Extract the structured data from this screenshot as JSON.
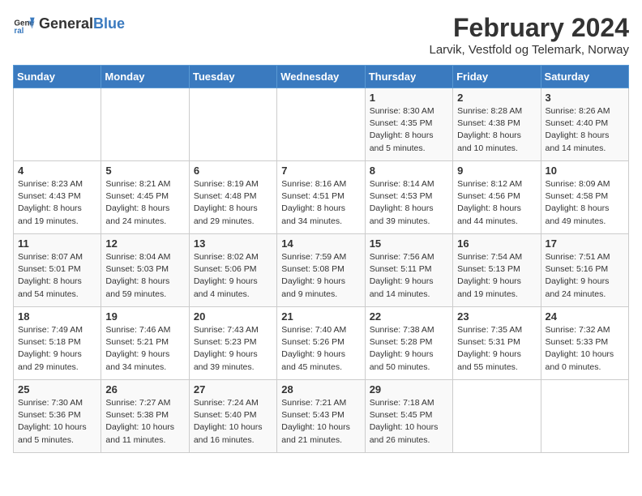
{
  "header": {
    "logo_general": "General",
    "logo_blue": "Blue",
    "month_year": "February 2024",
    "location": "Larvik, Vestfold og Telemark, Norway"
  },
  "calendar": {
    "days_of_week": [
      "Sunday",
      "Monday",
      "Tuesday",
      "Wednesday",
      "Thursday",
      "Friday",
      "Saturday"
    ],
    "weeks": [
      [
        {
          "day": "",
          "info": ""
        },
        {
          "day": "",
          "info": ""
        },
        {
          "day": "",
          "info": ""
        },
        {
          "day": "",
          "info": ""
        },
        {
          "day": "1",
          "info": "Sunrise: 8:30 AM\nSunset: 4:35 PM\nDaylight: 8 hours\nand 5 minutes."
        },
        {
          "day": "2",
          "info": "Sunrise: 8:28 AM\nSunset: 4:38 PM\nDaylight: 8 hours\nand 10 minutes."
        },
        {
          "day": "3",
          "info": "Sunrise: 8:26 AM\nSunset: 4:40 PM\nDaylight: 8 hours\nand 14 minutes."
        }
      ],
      [
        {
          "day": "4",
          "info": "Sunrise: 8:23 AM\nSunset: 4:43 PM\nDaylight: 8 hours\nand 19 minutes."
        },
        {
          "day": "5",
          "info": "Sunrise: 8:21 AM\nSunset: 4:45 PM\nDaylight: 8 hours\nand 24 minutes."
        },
        {
          "day": "6",
          "info": "Sunrise: 8:19 AM\nSunset: 4:48 PM\nDaylight: 8 hours\nand 29 minutes."
        },
        {
          "day": "7",
          "info": "Sunrise: 8:16 AM\nSunset: 4:51 PM\nDaylight: 8 hours\nand 34 minutes."
        },
        {
          "day": "8",
          "info": "Sunrise: 8:14 AM\nSunset: 4:53 PM\nDaylight: 8 hours\nand 39 minutes."
        },
        {
          "day": "9",
          "info": "Sunrise: 8:12 AM\nSunset: 4:56 PM\nDaylight: 8 hours\nand 44 minutes."
        },
        {
          "day": "10",
          "info": "Sunrise: 8:09 AM\nSunset: 4:58 PM\nDaylight: 8 hours\nand 49 minutes."
        }
      ],
      [
        {
          "day": "11",
          "info": "Sunrise: 8:07 AM\nSunset: 5:01 PM\nDaylight: 8 hours\nand 54 minutes."
        },
        {
          "day": "12",
          "info": "Sunrise: 8:04 AM\nSunset: 5:03 PM\nDaylight: 8 hours\nand 59 minutes."
        },
        {
          "day": "13",
          "info": "Sunrise: 8:02 AM\nSunset: 5:06 PM\nDaylight: 9 hours\nand 4 minutes."
        },
        {
          "day": "14",
          "info": "Sunrise: 7:59 AM\nSunset: 5:08 PM\nDaylight: 9 hours\nand 9 minutes."
        },
        {
          "day": "15",
          "info": "Sunrise: 7:56 AM\nSunset: 5:11 PM\nDaylight: 9 hours\nand 14 minutes."
        },
        {
          "day": "16",
          "info": "Sunrise: 7:54 AM\nSunset: 5:13 PM\nDaylight: 9 hours\nand 19 minutes."
        },
        {
          "day": "17",
          "info": "Sunrise: 7:51 AM\nSunset: 5:16 PM\nDaylight: 9 hours\nand 24 minutes."
        }
      ],
      [
        {
          "day": "18",
          "info": "Sunrise: 7:49 AM\nSunset: 5:18 PM\nDaylight: 9 hours\nand 29 minutes."
        },
        {
          "day": "19",
          "info": "Sunrise: 7:46 AM\nSunset: 5:21 PM\nDaylight: 9 hours\nand 34 minutes."
        },
        {
          "day": "20",
          "info": "Sunrise: 7:43 AM\nSunset: 5:23 PM\nDaylight: 9 hours\nand 39 minutes."
        },
        {
          "day": "21",
          "info": "Sunrise: 7:40 AM\nSunset: 5:26 PM\nDaylight: 9 hours\nand 45 minutes."
        },
        {
          "day": "22",
          "info": "Sunrise: 7:38 AM\nSunset: 5:28 PM\nDaylight: 9 hours\nand 50 minutes."
        },
        {
          "day": "23",
          "info": "Sunrise: 7:35 AM\nSunset: 5:31 PM\nDaylight: 9 hours\nand 55 minutes."
        },
        {
          "day": "24",
          "info": "Sunrise: 7:32 AM\nSunset: 5:33 PM\nDaylight: 10 hours\nand 0 minutes."
        }
      ],
      [
        {
          "day": "25",
          "info": "Sunrise: 7:30 AM\nSunset: 5:36 PM\nDaylight: 10 hours\nand 5 minutes."
        },
        {
          "day": "26",
          "info": "Sunrise: 7:27 AM\nSunset: 5:38 PM\nDaylight: 10 hours\nand 11 minutes."
        },
        {
          "day": "27",
          "info": "Sunrise: 7:24 AM\nSunset: 5:40 PM\nDaylight: 10 hours\nand 16 minutes."
        },
        {
          "day": "28",
          "info": "Sunrise: 7:21 AM\nSunset: 5:43 PM\nDaylight: 10 hours\nand 21 minutes."
        },
        {
          "day": "29",
          "info": "Sunrise: 7:18 AM\nSunset: 5:45 PM\nDaylight: 10 hours\nand 26 minutes."
        },
        {
          "day": "",
          "info": ""
        },
        {
          "day": "",
          "info": ""
        }
      ]
    ]
  }
}
